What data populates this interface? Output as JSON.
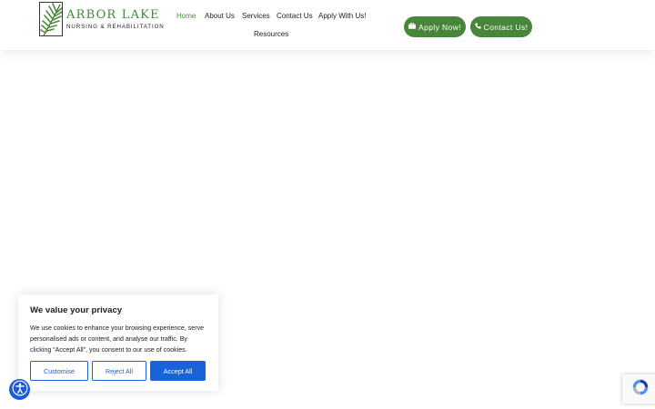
{
  "brand": {
    "name": "Arbor Lake",
    "tagline": "Nursing & Rehabilitation",
    "accent": "#48873b"
  },
  "nav": {
    "items": [
      {
        "label": "Home",
        "active": true
      },
      {
        "label": "About Us",
        "active": false
      },
      {
        "label": "Services",
        "active": false
      },
      {
        "label": "Contact Us",
        "active": false
      },
      {
        "label": "Apply With Us!",
        "active": false
      },
      {
        "label": "Resources",
        "active": false
      }
    ]
  },
  "cta": {
    "apply": {
      "label": "Apply Now!",
      "icon": "briefcase-icon"
    },
    "contact": {
      "label": "Contact Us!",
      "icon": "phone-icon"
    }
  },
  "cookie": {
    "title": "We value your privacy",
    "body": "We use cookies to enhance your browsing experience, serve personalised ads or content, and analyse our traffic. By clicking “Accept All”, you consent to our use of cookies.",
    "customise_label": "Customise",
    "reject_label": "Reject All",
    "accept_label": "Accept All",
    "button_color": "#1863dc"
  },
  "widgets": {
    "accessibility_icon": "accessibility-icon",
    "recaptcha_icon": "recaptcha-icon"
  }
}
